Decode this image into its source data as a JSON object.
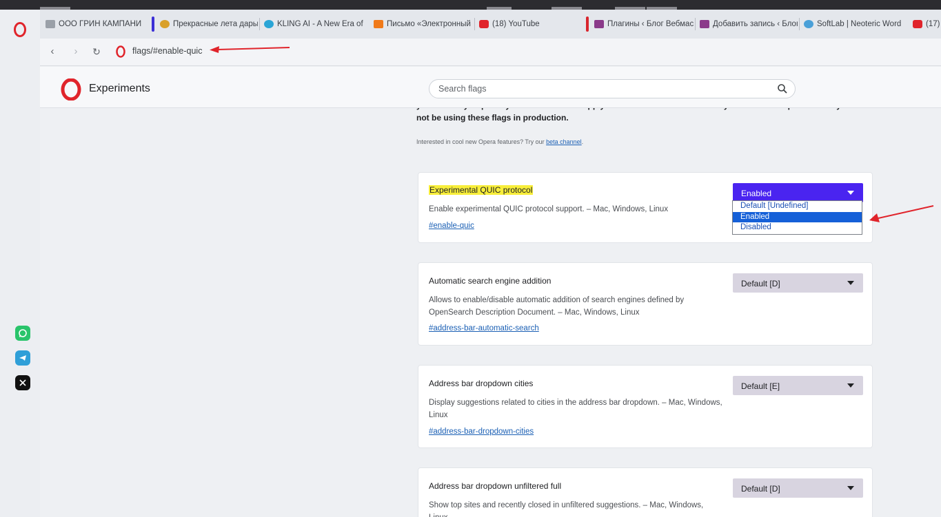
{
  "browser": {
    "tabs": [
      {
        "label": "ООО ГРИН КАМПАНИ",
        "icon": "document-favicon-icon"
      },
      {
        "label": "Прекрасные лета дары",
        "icon": "food-favicon-icon"
      },
      {
        "label": "KLING AI - A New Era of",
        "icon": "kling-favicon-icon"
      },
      {
        "label": "Письмо «Электронный",
        "icon": "mail-favicon-icon"
      },
      {
        "label": "(18) YouTube",
        "icon": "youtube-favicon-icon"
      },
      {
        "label": "Плагины ‹ Блог Вебмас",
        "icon": "wp-favicon-icon"
      },
      {
        "label": "Добавить запись ‹ Блог",
        "icon": "wp-favicon-icon"
      },
      {
        "label": "SoftLab | Neoteric Word",
        "icon": "softlab-favicon-icon"
      },
      {
        "label": "(17)",
        "icon": "youtube-favicon-icon"
      }
    ],
    "url": "flags/#enable-quic",
    "sidebar_apps": [
      "whatsapp-icon",
      "telegram-icon",
      "x-twitter-icon"
    ]
  },
  "page": {
    "title": "Experiments",
    "search_placeholder": "Search flags",
    "intro_line1": "your security or privacy. Enabled features apply to all users of this browser. If you are an enterprise admin you should",
    "intro_line2": "not be using these flags in production.",
    "beta_text": "Interested in cool new Opera features? Try our",
    "beta_link": "beta channel",
    "beta_end": "."
  },
  "flags": [
    {
      "title": "Experimental QUIC protocol",
      "description": "Enable experimental QUIC protocol support. – Mac, Windows, Linux",
      "hash": "#enable-quic",
      "value": "Enabled"
    },
    {
      "title": "Automatic search engine addition",
      "description": "Allows to enable/disable automatic addition of search engines defined by OpenSearch Description Document. – Mac, Windows, Linux",
      "hash": "#address-bar-automatic-search",
      "value": "Default [D]"
    },
    {
      "title": "Address bar dropdown cities",
      "description": "Display suggestions related to cities in the address bar dropdown. – Mac, Windows, Linux",
      "hash": "#address-bar-dropdown-cities",
      "value": "Default [E]"
    },
    {
      "title": "Address bar dropdown unfiltered full",
      "description": "Show top sites and recently closed in unfiltered suggestions. – Mac, Windows, Linux",
      "hash": "",
      "value": "Default [D]"
    }
  ],
  "dropdown_options": [
    "Default [Undefined]",
    "Enabled",
    "Disabled"
  ],
  "colors": {
    "opera_red": "#e0242b",
    "select_active": "#4a24f0",
    "highlight": "#f8ee3a",
    "annotation_arrow": "#e0242b"
  }
}
